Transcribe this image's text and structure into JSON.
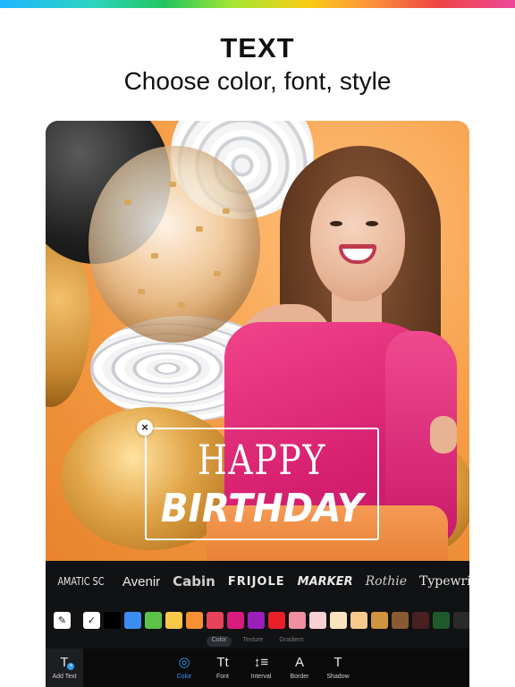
{
  "header": {
    "title": "TEXT",
    "subtitle": "Choose color, font, style"
  },
  "overlay_text": {
    "line1": "HAPPY",
    "line2": "BIRTHDAY",
    "close_glyph": "×"
  },
  "fonts": [
    "AMATIC SC",
    "Avenir",
    "Cabin",
    "FRIJOLE",
    "MARKER",
    "Rothie",
    "Typewriter"
  ],
  "swatches": {
    "tools": [
      {
        "icon": "eyedropper-icon",
        "glyph": "✎"
      },
      {
        "icon": "check-icon",
        "glyph": "✓"
      }
    ],
    "colors": [
      "#000000",
      "#3b8ef0",
      "#5cc24a",
      "#f7c84a",
      "#f59035",
      "#e8425a",
      "#d91b7c",
      "#9b1fbd",
      "#e8202a",
      "#ef8fa0",
      "#fbd0d3",
      "#fde3bd",
      "#f8c98c",
      "#cf9440",
      "#8a5a32",
      "#4a1f22",
      "#1e5a2a",
      "#2a2a2a"
    ]
  },
  "color_modes": {
    "items": [
      "Color",
      "Texture",
      "Gradient"
    ],
    "active": "Color"
  },
  "toolbar": {
    "add_text": "Add Text",
    "items": [
      {
        "label": "Color",
        "icon": "palette-icon",
        "glyph": "◎",
        "active": true
      },
      {
        "label": "Font",
        "icon": "font-icon",
        "glyph": "Tt",
        "active": false
      },
      {
        "label": "Interval",
        "icon": "line-spacing-icon",
        "glyph": "↕≡",
        "active": false
      },
      {
        "label": "Border",
        "icon": "border-letter-icon",
        "glyph": "A",
        "active": false
      },
      {
        "label": "Shadow",
        "icon": "shadow-letter-icon",
        "glyph": "T",
        "active": false
      }
    ]
  },
  "colors": {
    "accent": "#2f9cf5",
    "editor_bg": "#111214",
    "photo_bg": "#f6a64b"
  }
}
